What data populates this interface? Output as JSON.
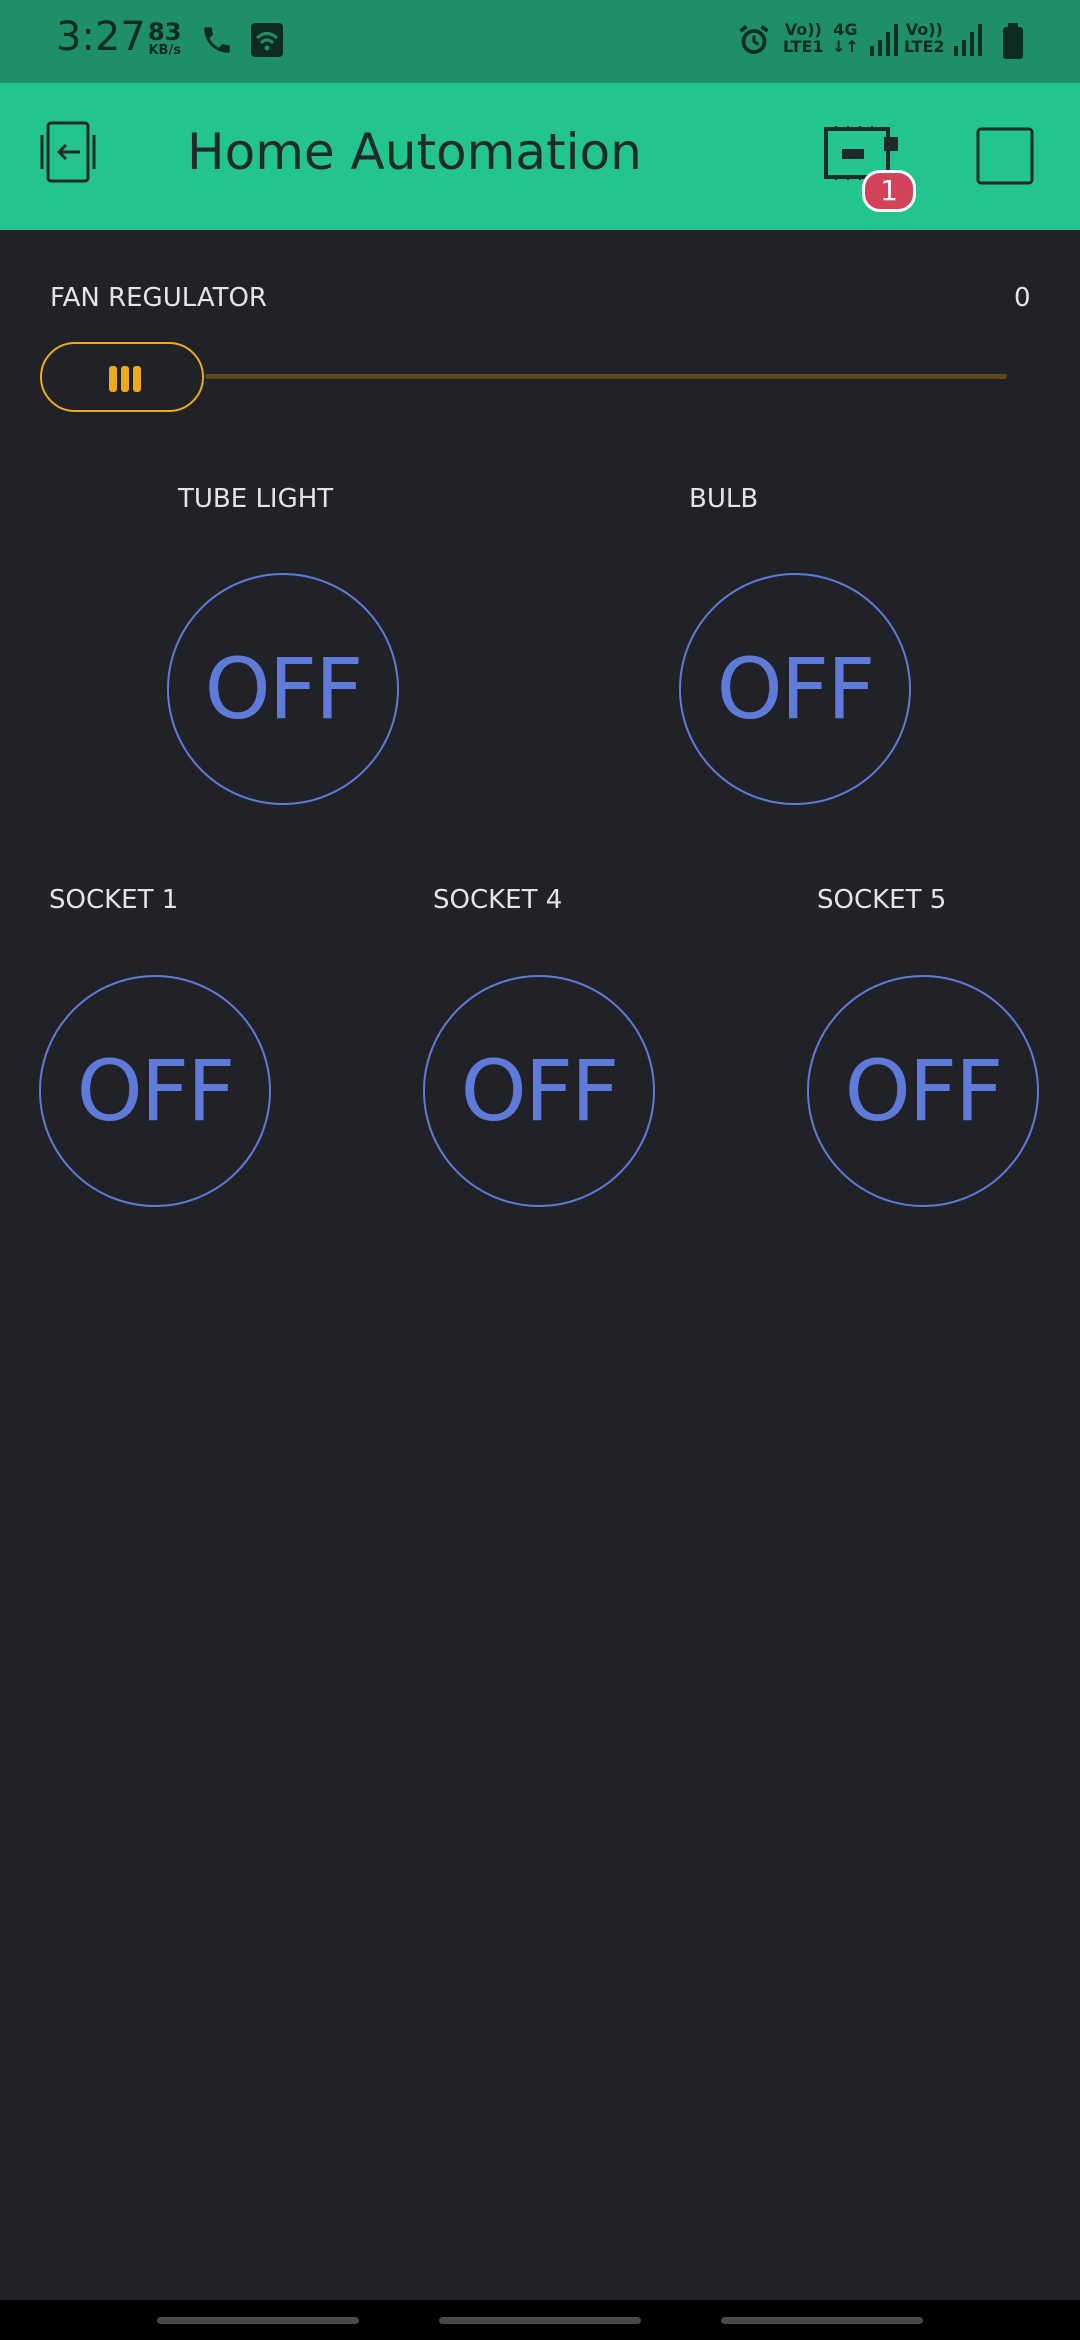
{
  "status_bar": {
    "time": "3:27",
    "speed_value": "83",
    "speed_unit": "KB/s",
    "sim1_top": "Vo))",
    "sim1_bottom": "LTE1",
    "net_top": "4G",
    "net_bottom": "↓↑",
    "sim2_top": "Vo))",
    "sim2_bottom": "LTE2"
  },
  "app_bar": {
    "title": "Home Automation",
    "device_badge": "1",
    "background_color": "#23c48e"
  },
  "slider": {
    "label": "FAN REGULATOR",
    "value_text": "0",
    "value": 0,
    "accent_color": "#ecaa1e"
  },
  "switches_row1": [
    {
      "label": "TUBE LIGHT",
      "state": "OFF"
    },
    {
      "label": "BULB",
      "state": "OFF"
    }
  ],
  "switches_row2": [
    {
      "label": "SOCKET 1",
      "state": "OFF"
    },
    {
      "label": "SOCKET 4",
      "state": "OFF"
    },
    {
      "label": "SOCKET 5",
      "state": "OFF"
    }
  ],
  "colors": {
    "background": "#212227",
    "button_accent": "#5f7bd9"
  }
}
